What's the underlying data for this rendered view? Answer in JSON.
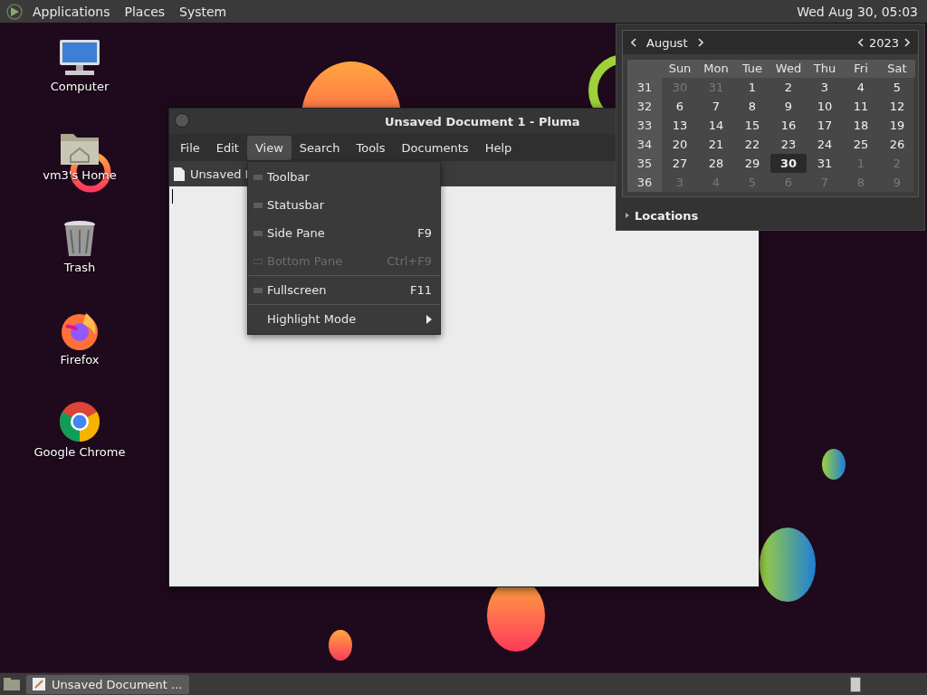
{
  "top_panel": {
    "menus": [
      "Applications",
      "Places",
      "System"
    ],
    "clock": "Wed Aug 30, 05:03"
  },
  "desktop_icons": [
    {
      "kind": "computer",
      "label": "Computer"
    },
    {
      "kind": "home",
      "label": "vm3's Home"
    },
    {
      "kind": "trash",
      "label": "Trash"
    },
    {
      "kind": "firefox",
      "label": "Firefox"
    },
    {
      "kind": "chrome",
      "label": "Google Chrome"
    }
  ],
  "window": {
    "title": "Unsaved Document 1 - Pluma",
    "menus": [
      {
        "label": "File",
        "selected": false
      },
      {
        "label": "Edit",
        "selected": false
      },
      {
        "label": "View",
        "selected": true
      },
      {
        "label": "Search",
        "selected": false
      },
      {
        "label": "Tools",
        "selected": false
      },
      {
        "label": "Documents",
        "selected": false
      },
      {
        "label": "Help",
        "selected": false
      }
    ],
    "tab": "Unsaved I",
    "view_menu": [
      {
        "kind": "check",
        "label": "Toolbar",
        "checked": false,
        "disabled": false
      },
      {
        "kind": "check",
        "label": "Statusbar",
        "checked": false,
        "disabled": false
      },
      {
        "kind": "check",
        "label": "Side Pane",
        "shortcut": "F9",
        "checked": false,
        "disabled": false
      },
      {
        "kind": "check",
        "label": "Bottom Pane",
        "shortcut": "Ctrl+F9",
        "checked": false,
        "disabled": true
      },
      {
        "kind": "separator"
      },
      {
        "kind": "check",
        "label": "Fullscreen",
        "shortcut": "F11",
        "checked": false,
        "disabled": false
      },
      {
        "kind": "separator"
      },
      {
        "kind": "submenu",
        "label": "Highlight Mode",
        "disabled": false
      }
    ]
  },
  "calendar": {
    "month": "August",
    "year": "2023",
    "weekdays": [
      "Sun",
      "Mon",
      "Tue",
      "Wed",
      "Thu",
      "Fri",
      "Sat"
    ],
    "weeks": [
      {
        "number": "31",
        "days": [
          {
            "label": "30",
            "muted": true,
            "selected": false
          },
          {
            "label": "31",
            "muted": true,
            "selected": false
          },
          {
            "label": "1",
            "muted": false,
            "selected": false
          },
          {
            "label": "2",
            "muted": false,
            "selected": false
          },
          {
            "label": "3",
            "muted": false,
            "selected": false
          },
          {
            "label": "4",
            "muted": false,
            "selected": false
          },
          {
            "label": "5",
            "muted": false,
            "selected": false
          }
        ]
      },
      {
        "number": "32",
        "days": [
          {
            "label": "6",
            "muted": false,
            "selected": false
          },
          {
            "label": "7",
            "muted": false,
            "selected": false
          },
          {
            "label": "8",
            "muted": false,
            "selected": false
          },
          {
            "label": "9",
            "muted": false,
            "selected": false
          },
          {
            "label": "10",
            "muted": false,
            "selected": false
          },
          {
            "label": "11",
            "muted": false,
            "selected": false
          },
          {
            "label": "12",
            "muted": false,
            "selected": false
          }
        ]
      },
      {
        "number": "33",
        "days": [
          {
            "label": "13",
            "muted": false,
            "selected": false
          },
          {
            "label": "14",
            "muted": false,
            "selected": false
          },
          {
            "label": "15",
            "muted": false,
            "selected": false
          },
          {
            "label": "16",
            "muted": false,
            "selected": false
          },
          {
            "label": "17",
            "muted": false,
            "selected": false
          },
          {
            "label": "18",
            "muted": false,
            "selected": false
          },
          {
            "label": "19",
            "muted": false,
            "selected": false
          }
        ]
      },
      {
        "number": "34",
        "days": [
          {
            "label": "20",
            "muted": false,
            "selected": false
          },
          {
            "label": "21",
            "muted": false,
            "selected": false
          },
          {
            "label": "22",
            "muted": false,
            "selected": false
          },
          {
            "label": "23",
            "muted": false,
            "selected": false
          },
          {
            "label": "24",
            "muted": false,
            "selected": false
          },
          {
            "label": "25",
            "muted": false,
            "selected": false
          },
          {
            "label": "26",
            "muted": false,
            "selected": false
          }
        ]
      },
      {
        "number": "35",
        "days": [
          {
            "label": "27",
            "muted": false,
            "selected": false
          },
          {
            "label": "28",
            "muted": false,
            "selected": false
          },
          {
            "label": "29",
            "muted": false,
            "selected": false
          },
          {
            "label": "30",
            "muted": false,
            "selected": true
          },
          {
            "label": "31",
            "muted": false,
            "selected": false
          },
          {
            "label": "1",
            "muted": true,
            "selected": false
          },
          {
            "label": "2",
            "muted": true,
            "selected": false
          }
        ]
      },
      {
        "number": "36",
        "days": [
          {
            "label": "3",
            "muted": true,
            "selected": false
          },
          {
            "label": "4",
            "muted": true,
            "selected": false
          },
          {
            "label": "5",
            "muted": true,
            "selected": false
          },
          {
            "label": "6",
            "muted": true,
            "selected": false
          },
          {
            "label": "7",
            "muted": true,
            "selected": false
          },
          {
            "label": "8",
            "muted": true,
            "selected": false
          },
          {
            "label": "9",
            "muted": true,
            "selected": false
          }
        ]
      }
    ],
    "locations": {
      "label": "Locations",
      "expanded": false
    }
  },
  "taskbar": {
    "tasks": [
      {
        "label": "Unsaved Document ...",
        "selected": true
      }
    ]
  }
}
